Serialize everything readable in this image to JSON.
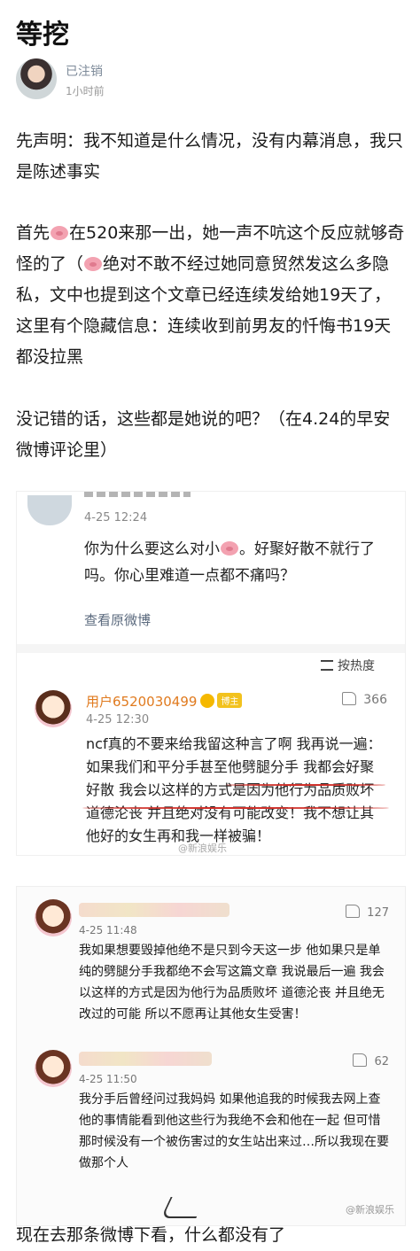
{
  "post": {
    "title": "等挖",
    "author": "已注销",
    "time": "1小时前",
    "paragraphs": [
      "先声明：我不知道是什么情况，没有内幕消息，我只是陈述事实",
      "在520来那一出，她一声不吭这个反应就够奇怪的了（",
      "绝对不敢不经过她同意贸然发这么多隐私，文中也提到这个文章已经连续发给她19天了，这里有个隐藏信息：连续收到前男友的忏悔书19天都没拉黑",
      "没记错的话，这些都是她说的吧？（在4.24的早安微博评论里）"
    ],
    "p2_prefix": "首先",
    "last_line": "现在去那条微博下看，什么都没有了"
  },
  "shot1": {
    "date": "4-25 12:24",
    "text_a": "你为什么要这么对小",
    "text_b": "。好聚好散不就行了吗。你心里难道一点都不痛吗？",
    "view_original": "查看原微博",
    "sort": "按热度",
    "comment": {
      "user": "用户6520030499",
      "badge": "博主",
      "likes": "366",
      "date": "4-25 12:30",
      "body": "ncf真的不要来给我留这种言了啊 我再说一遍：如果我们和平分手甚至他劈腿分手 我都会好聚好散 我会以这样的方式是因为他行为品质败坏 道德沦丧 并且绝对没有可能改变！我不想让其他好的女生再和我一样被骗！"
    },
    "watermark": "@新浪娱乐"
  },
  "shot2": {
    "comments": [
      {
        "likes": "127",
        "date": "4-25 11:48",
        "body": "我如果想要毁掉他绝不是只到今天这一步 他如果只是单纯的劈腿分手我都绝不会写这篇文章 我说最后一遍 我会以这样的方式是因为他行为品质败坏 道德沦丧 并且绝无改过的可能 所以不愿再让其他女生受害！"
      },
      {
        "likes": "62",
        "date": "4-25 11:50",
        "body": "我分手后曾经问过我妈妈 如果他追我的时候我去网上查他的事情能看到他这些行为我绝不会和他在一起 但可惜那时候没有一个被伤害过的女生站出来过…所以我现在要做那个人"
      }
    ],
    "watermark": "@新浪娱乐"
  }
}
